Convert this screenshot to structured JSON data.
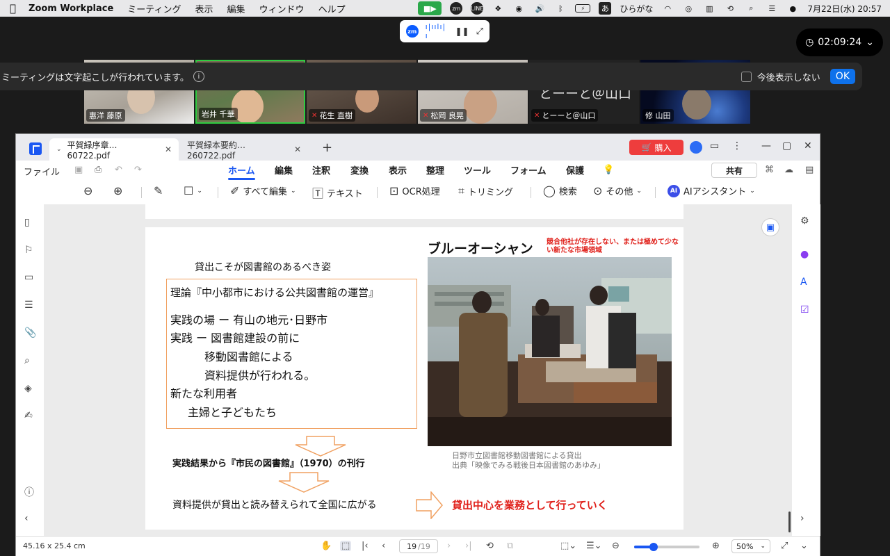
{
  "menubar": {
    "app_name": "Zoom Workplace",
    "items": [
      "ミーティング",
      "表示",
      "編集",
      "ウィンドウ",
      "ヘルプ"
    ],
    "ime_label": "ひらがな",
    "ime_badge": "あ",
    "datetime": "7月22日(水)  20:57"
  },
  "timer": "02:09:24",
  "banner": {
    "text": "ミーティングは文字起こしが行われています。",
    "dont_show": "今後表示しない",
    "ok": "OK"
  },
  "participants": [
    {
      "name": "惠洋 藤原",
      "muted": false
    },
    {
      "name": "岩井 千華",
      "muted": false
    },
    {
      "name": "花生 直樹",
      "muted": true
    },
    {
      "name": "松岡 良晃",
      "muted": true
    },
    {
      "name": "とーーと＠山口",
      "muted": true,
      "display_text": "とーーと＠山口"
    },
    {
      "name": "修 山田",
      "muted": false
    }
  ],
  "pdf": {
    "tabs": [
      {
        "label": "平賀緑序章…60722.pdf",
        "active": true
      },
      {
        "label": "平賀緑本要約…260722.pdf",
        "active": false
      }
    ],
    "buy": "購入",
    "file": "ファイル",
    "menu": [
      "ホーム",
      "編集",
      "注釈",
      "変換",
      "表示",
      "整理",
      "ツール",
      "フォーム",
      "保護"
    ],
    "active_menu": "ホーム",
    "share": "共有",
    "tools": {
      "edit_all": "すべて編集",
      "text": "テキスト",
      "ocr": "OCR処理",
      "trim": "トリミング",
      "search": "検索",
      "more": "その他",
      "ai": "AIアシスタント",
      "ai_badge": "AI"
    },
    "status": {
      "dimensions": "45.16 x 25.4 cm",
      "page_current": "19",
      "page_total": "/19",
      "zoom": "50%",
      "zoom_level": 0.3
    }
  },
  "slide": {
    "heading": "貸出こそが図書館のあるべき姿",
    "theory": "理論『中小都市における公共図書館の運営』",
    "lines": [
      "実践の場 ー 有山の地元･日野市",
      "実践 ー 図書館建設の前に",
      "移動図書館による",
      "資料提供が行われる。",
      "新たな利用者",
      "主婦と子どもたち"
    ],
    "result": "実践結果から『市民の図書館』（1970）の刊行",
    "spread": "資料提供が貸出と読み替えられて全国に広がる",
    "lending": "貸出中心を業務として行っていく",
    "blue_ocean_title": "ブルーオーシャン",
    "blue_ocean_note": "競合他社が存在しない、または極めて少ない新たな市場領域",
    "caption_1": "日野市立図書館移動図書館による貸出",
    "caption_2": "出典「映像でみる戦後日本図書館のあゆみ」"
  },
  "colors": {
    "accent": "#1a57f2",
    "buy_red": "#ee3d3d",
    "slide_red": "#e0201a",
    "box_orange": "#f0a060",
    "zoom_blue": "#0e71eb"
  }
}
